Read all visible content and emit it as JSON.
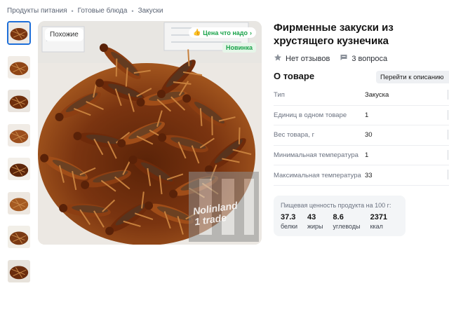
{
  "breadcrumb": [
    "Продукты питания",
    "Готовые блюда",
    "Закуски"
  ],
  "gallery": {
    "thumbnail_count": 8,
    "active_index": 0,
    "similar_label": "Похожие",
    "deal_label": "Цена что надо",
    "new_label": "Новинка",
    "watermark_line1": "Nolinland",
    "watermark_line2": "1 trade"
  },
  "product": {
    "title": "Фирменные закуски из хрустящего кузнечика",
    "reviews_label": "Нет отзывов",
    "questions_label": "3 вопроса"
  },
  "about": {
    "title": "О товаре",
    "to_description_button": "Перейти к описанию",
    "specs": [
      {
        "key": "Тип",
        "value": "Закуска"
      },
      {
        "key": "Единиц в одном товаре",
        "value": "1"
      },
      {
        "key": "Вес товара, г",
        "value": "30"
      },
      {
        "key": "Минимальная температура",
        "value": "1"
      },
      {
        "key": "Максимальная температура",
        "value": "33"
      }
    ]
  },
  "nutrition": {
    "title": "Пищевая ценность продукта на 100 г:",
    "items": [
      {
        "value": "37.3",
        "label": "белки"
      },
      {
        "value": "43",
        "label": "жиры"
      },
      {
        "value": "8.6",
        "label": "углеводы"
      },
      {
        "value": "2371",
        "label": "ккал"
      }
    ]
  },
  "colors": {
    "accent_blue": "#1e6fd9",
    "badge_green": "#1aa34a",
    "food_brown": "#7a3410"
  },
  "icons": {
    "reviews": "star-icon",
    "questions": "chat-icon",
    "deal": "thumbs-up-icon"
  }
}
